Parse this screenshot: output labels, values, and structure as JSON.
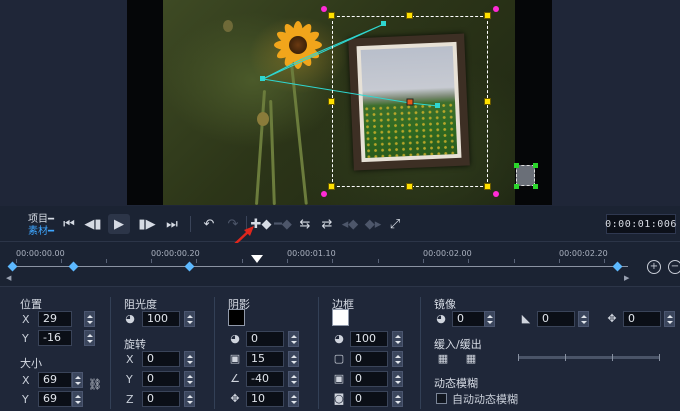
{
  "playback": {
    "project_label": "项目",
    "clip_label": "素材",
    "timecode": "0:00:01:006"
  },
  "timeline": {
    "ticks": [
      "00:00:00.00",
      "00:00:00.20",
      "00:00:01.10",
      "00:00:02.00",
      "00:00:02.20"
    ],
    "zoom_in_glyph": "+",
    "zoom_out_glyph": "−"
  },
  "properties": {
    "position": {
      "title": "位置",
      "x_label": "X",
      "x": "29",
      "y_label": "Y",
      "y": "-16"
    },
    "size": {
      "title": "大小",
      "x_label": "X",
      "x": "69",
      "y_label": "Y",
      "y": "69"
    },
    "opacity": {
      "title": "阻光度",
      "value": "100"
    },
    "rotation": {
      "title": "旋转",
      "x_label": "X",
      "x": "0",
      "y_label": "Y",
      "y": "0",
      "z_label": "Z",
      "z": "0"
    },
    "shadow": {
      "title": "阴影",
      "color": "#000000",
      "opacity": "0",
      "blur": "15",
      "angle": "-40",
      "distance": "10"
    },
    "border": {
      "title": "边框",
      "color": "#ffffff",
      "opacity": "100",
      "width": "0",
      "blur": "0",
      "inner": "0"
    },
    "mirror": {
      "title": "镜像",
      "opacity": "0",
      "tilt": "0",
      "offset": "0"
    },
    "fade": {
      "title": "缓入/缓出"
    },
    "motion_blur": {
      "title": "动态模糊",
      "auto_label": "自动动态模糊",
      "auto_checked": false
    }
  },
  "colors": {
    "accent": "#3ea6ff",
    "handle_yellow": "#ffe100",
    "handle_magenta": "#ff2bd6",
    "path": "#2fd6d0",
    "annotation_arrow": "#e0261c"
  }
}
